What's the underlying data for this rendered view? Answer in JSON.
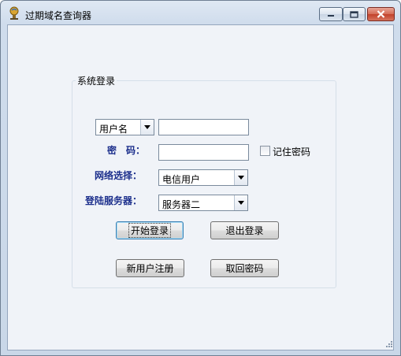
{
  "window": {
    "title": "过期域名查询器",
    "controls": {
      "minimize": "minimize-icon",
      "maximize": "maximize-icon",
      "close": "close-icon"
    }
  },
  "login_group": {
    "legend": "系统登录",
    "account_type": {
      "selected": "用户名"
    },
    "username_value": "",
    "password_label": "密　码：",
    "password_value": "",
    "remember_label": "记住密码",
    "remember_checked": false,
    "network_label": "网络选择：",
    "network": {
      "selected": "电信用户"
    },
    "server_label": "登陆服务器：",
    "server": {
      "selected": "服务器二"
    }
  },
  "buttons": {
    "login": "开始登录",
    "exit": "退出登录",
    "register": "新用户注册",
    "recover": "取回密码"
  },
  "colors": {
    "label_blue": "#1c2f8c",
    "titlebar": "#dfe8f3",
    "close_red": "#c2422b"
  }
}
